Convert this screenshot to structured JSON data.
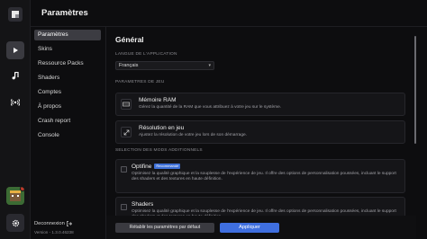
{
  "app": {
    "title": "Paramètres"
  },
  "nav": {
    "items": [
      {
        "label": "Paramètres",
        "active": true
      },
      {
        "label": "Skins"
      },
      {
        "label": "Ressource Packs"
      },
      {
        "label": "Shaders"
      },
      {
        "label": "Comptes"
      },
      {
        "label": "À propos"
      },
      {
        "label": "Crash report"
      },
      {
        "label": "Console"
      }
    ],
    "logout_label": "Deconnexion",
    "version": "Version - 1.3.0.46238"
  },
  "rail": {
    "icons": [
      "play-icon",
      "music-note-icon",
      "broadcast-icon",
      "gear-icon"
    ]
  },
  "general": {
    "title": "Général",
    "language_label": "LANGUE DE L'APPLICATION",
    "language_value": "Français",
    "game_params_label": "PARAMETRES DE JEU",
    "ram": {
      "title": "Mémoire RAM",
      "description": "Gérez la quantité de la RAM que vous attribuez à votre jeu sur le système."
    },
    "resolution": {
      "title": "Résolution en jeu",
      "description": "Ajustez la résolution de votre jeu lors de son démarrage."
    },
    "mods_label": "SELECTION DES MODS ADDITIONNELS",
    "optifine": {
      "title": "Optifine",
      "badge": "Recommandé",
      "description": "Optimisez la qualité graphique et la souplesse de l'expérience de jeu. Il offre des options de personnalisation poussées, incluant le support des shaders et des textures en haute définition."
    },
    "shaders": {
      "title": "Shaders",
      "description": "Optimisez la qualité graphique et la souplesse de l'expérience de jeu. Il offre des options de personnalisation poussées, incluant le support des shaders et des textures en haute définition."
    }
  },
  "footer": {
    "reset_label": "Rétablir les paramètres par défaut",
    "apply_label": "Appliquer"
  },
  "colors": {
    "accent": "#3f6fe0",
    "background": "#0d0d0f"
  }
}
